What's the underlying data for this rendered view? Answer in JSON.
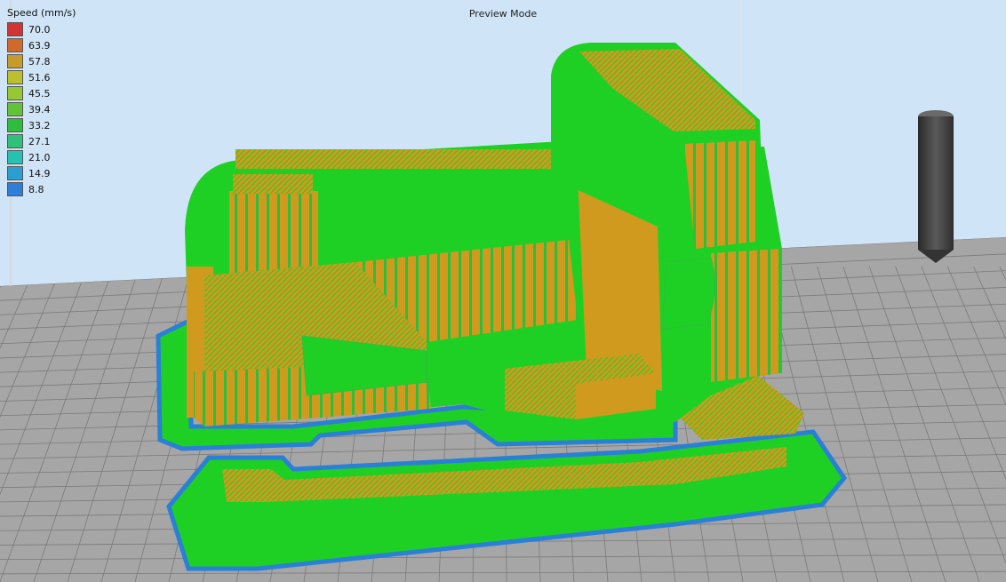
{
  "header": {
    "mode_label": "Preview Mode"
  },
  "legend": {
    "title": "Speed (mm/s)",
    "items": [
      {
        "label": "70.0",
        "color": "#d03434"
      },
      {
        "label": "63.9",
        "color": "#cf6a2c"
      },
      {
        "label": "57.8",
        "color": "#c79a2c"
      },
      {
        "label": "51.6",
        "color": "#bcbf2e"
      },
      {
        "label": "45.5",
        "color": "#95c832"
      },
      {
        "label": "39.4",
        "color": "#62c238"
      },
      {
        "label": "33.2",
        "color": "#2fbd3c"
      },
      {
        "label": "27.1",
        "color": "#2fc07a"
      },
      {
        "label": "21.0",
        "color": "#25c2b2"
      },
      {
        "label": "14.9",
        "color": "#2a9fd0"
      },
      {
        "label": "8.8",
        "color": "#2f7fd8"
      }
    ]
  },
  "colors": {
    "sky": "#cfe4f6",
    "build_plate": "#a6a6a6",
    "grid_line": "#7a7a7a",
    "infill_orange": "#cf9a1e",
    "wall_green": "#1fd024",
    "skirt_blue": "#2a7fd6",
    "nozzle": "#444444"
  },
  "icons": {
    "nozzle": "print-nozzle-icon"
  }
}
